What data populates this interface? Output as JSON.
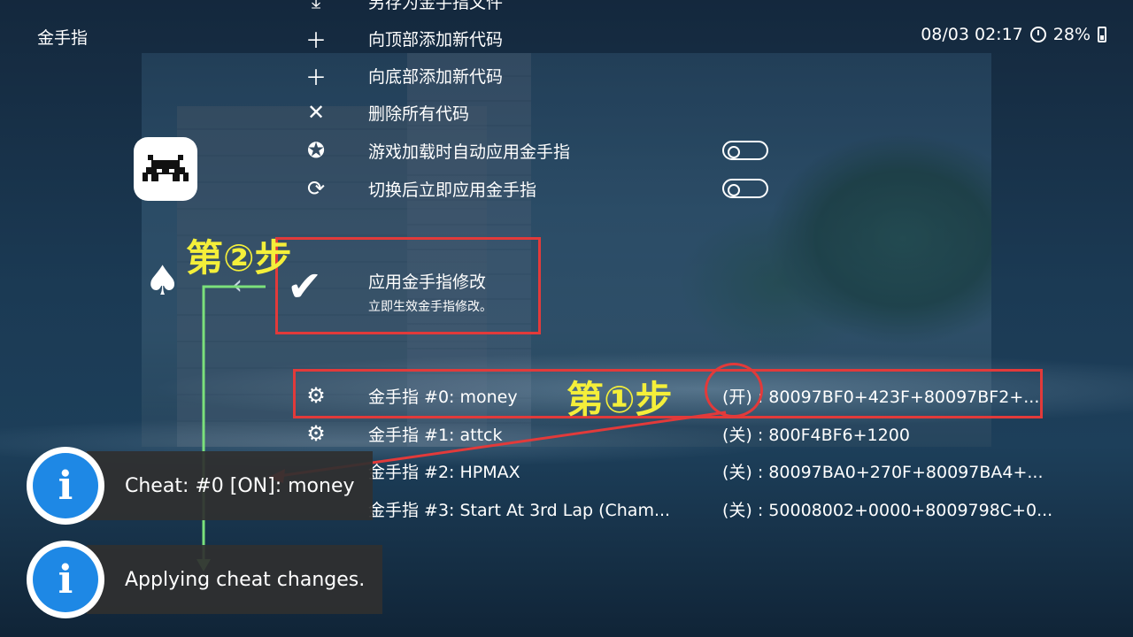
{
  "header": {
    "title": "金手指",
    "datetime": "08/03 02:17",
    "battery": "28%"
  },
  "menu": {
    "top_partial": "另存为金手指文件",
    "items": [
      {
        "icon": "plus-icon",
        "label": "向顶部添加新代码"
      },
      {
        "icon": "plus-icon",
        "label": "向底部添加新代码"
      },
      {
        "icon": "close-icon",
        "label": "删除所有代码"
      },
      {
        "icon": "badge-check-icon",
        "label": "游戏加载时自动应用金手指",
        "toggle": "off"
      },
      {
        "icon": "refresh-check-icon",
        "label": "切换后立即应用金手指",
        "toggle": "off"
      }
    ],
    "selected": {
      "label": "应用金手指修改",
      "sublabel": "立即生效金手指修改。"
    },
    "cheats": [
      {
        "label": "金手指 #0: money",
        "value": "(开) : 80097BF0+423F+80097BF2+..."
      },
      {
        "label": "金手指 #1: attck",
        "value": "(关) : 800F4BF6+1200"
      },
      {
        "label": "金手指 #2: HPMAX",
        "value": "(关) : 80097BA0+270F+80097BA4+..."
      },
      {
        "label": "金手指 #3: Start At 3rd Lap (Cham...",
        "value": "(关) : 50008002+0000+8009798C+0..."
      }
    ]
  },
  "annotations": {
    "step1": "第①步",
    "step2": "第②步",
    "color_box": "#e23a3a",
    "color_step": "#f4ef3a"
  },
  "notifications": [
    {
      "text": "Cheat: #0 [ON]: money"
    },
    {
      "text": "Applying cheat changes."
    }
  ]
}
